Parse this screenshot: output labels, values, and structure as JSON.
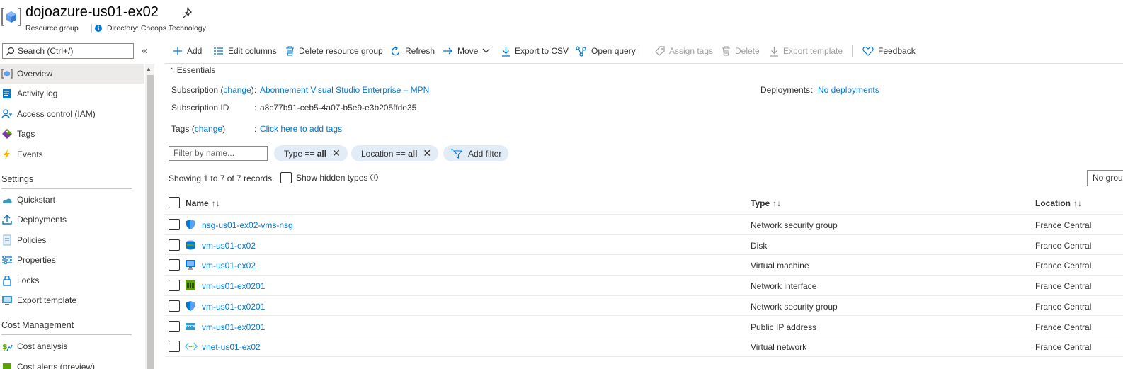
{
  "header": {
    "title": "dojoazure-us01-ex02",
    "subtitle": "Resource group",
    "directory": "Directory: Cheops Technology"
  },
  "search": {
    "placeholder": "Search (Ctrl+/)"
  },
  "sidebar": {
    "items": [
      {
        "label": "Overview",
        "icon": "overview-icon",
        "selected": true
      },
      {
        "label": "Activity log",
        "icon": "activity-log-icon"
      },
      {
        "label": "Access control (IAM)",
        "icon": "iam-icon"
      },
      {
        "label": "Tags",
        "icon": "tag-icon"
      },
      {
        "label": "Events",
        "icon": "lightning-icon"
      }
    ],
    "settings_heading": "Settings",
    "settings_items": [
      {
        "label": "Quickstart",
        "icon": "quickstart-icon"
      },
      {
        "label": "Deployments",
        "icon": "deployments-icon"
      },
      {
        "label": "Policies",
        "icon": "policies-icon"
      },
      {
        "label": "Properties",
        "icon": "properties-icon"
      },
      {
        "label": "Locks",
        "icon": "lock-icon"
      },
      {
        "label": "Export template",
        "icon": "export-template-icon"
      }
    ],
    "cost_heading": "Cost Management",
    "cost_items": [
      {
        "label": "Cost analysis",
        "icon": "cost-analysis-icon"
      },
      {
        "label": "Cost alerts (preview)",
        "icon": "cost-alerts-icon"
      }
    ]
  },
  "toolbar": {
    "add": "Add",
    "edit_columns": "Edit columns",
    "delete_rg": "Delete resource group",
    "refresh": "Refresh",
    "move": "Move",
    "export_csv": "Export to CSV",
    "open_query": "Open query",
    "assign_tags": "Assign tags",
    "delete": "Delete",
    "export_template": "Export template",
    "feedback": "Feedback"
  },
  "essentials": {
    "heading": "Essentials",
    "subscription_label": "Subscription",
    "change": "change",
    "subscription_value": "Abonnement Visual Studio Enterprise – MPN",
    "subscription_id_label": "Subscription ID",
    "subscription_id_value": "a8c77b91-ceb5-4a07-b5e9-e3b205ffde35",
    "tags_label": "Tags",
    "tags_value": "Click here to add tags",
    "deployments_label": "Deployments",
    "deployments_value": "No deployments"
  },
  "filters": {
    "name_placeholder": "Filter by name...",
    "type_label": "Type ==",
    "type_value": "all",
    "location_label": "Location ==",
    "location_value": "all",
    "add_filter": "Add filter"
  },
  "records": {
    "showing": "Showing 1 to 7 of 7 records.",
    "show_hidden": "Show hidden types",
    "grouping": "No grouping"
  },
  "table": {
    "columns": {
      "name": "Name",
      "type": "Type",
      "location": "Location"
    },
    "rows": [
      {
        "name": "nsg-us01-ex02-vms-nsg",
        "type": "Network security group",
        "location": "France Central",
        "icon": "nsg-shield-icon"
      },
      {
        "name": "vm-us01-ex02",
        "type": "Disk",
        "location": "France Central",
        "icon": "disk-icon"
      },
      {
        "name": "vm-us01-ex02",
        "type": "Virtual machine",
        "location": "France Central",
        "icon": "virtual-machine-icon"
      },
      {
        "name": "vm-us01-ex0201",
        "type": "Network interface",
        "location": "France Central",
        "icon": "network-interface-icon"
      },
      {
        "name": "vm-us01-ex0201",
        "type": "Network security group",
        "location": "France Central",
        "icon": "nsg-shield-icon"
      },
      {
        "name": "vm-us01-ex0201",
        "type": "Public IP address",
        "location": "France Central",
        "icon": "public-ip-icon"
      },
      {
        "name": "vnet-us01-ex02",
        "type": "Virtual network",
        "location": "France Central",
        "icon": "virtual-network-icon"
      }
    ]
  }
}
